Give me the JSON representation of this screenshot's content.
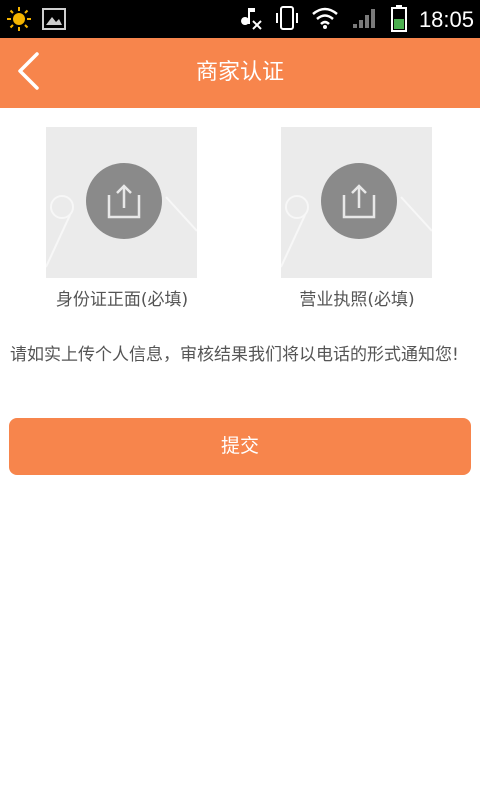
{
  "status_bar": {
    "time": "18:05",
    "left_icons": [
      "weather-icon",
      "gallery-icon"
    ],
    "right_icons": [
      "music-mute-icon",
      "vibrate-icon",
      "wifi-icon",
      "signal-icon",
      "battery-icon"
    ]
  },
  "header": {
    "title": "商家认证",
    "back_icon": "chevron-left-icon"
  },
  "uploads": [
    {
      "label": "身份证正面(必填)",
      "icon": "upload-icon"
    },
    {
      "label": "营业执照(必填)",
      "icon": "upload-icon"
    }
  ],
  "notice": "请如实上传个人信息，审核结果我们将以电话的形式通知您!",
  "submit_label": "提交",
  "colors": {
    "accent": "#f7854c",
    "upload_bg": "#ebebeb",
    "upload_icon_bg": "#8a8a8a",
    "text_secondary": "#555555"
  }
}
